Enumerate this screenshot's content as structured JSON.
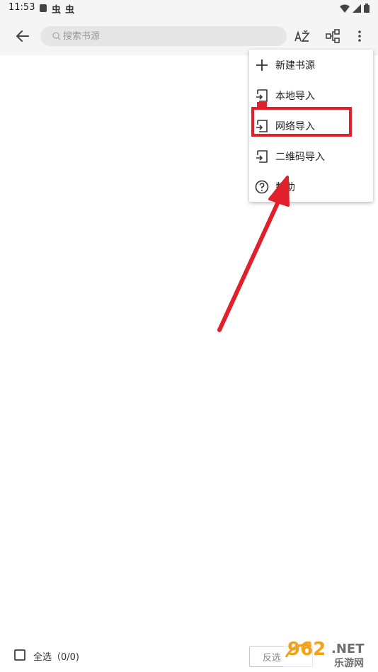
{
  "status_bar": {
    "time": "11:53",
    "bug_glyph_1": "虫",
    "bug_glyph_2": "虫"
  },
  "toolbar": {
    "search_placeholder": "搜索书源",
    "icons": [
      "back-arrow-icon",
      "search-icon",
      "sort-az-icon",
      "group-icon",
      "more-vert-icon"
    ]
  },
  "menu": {
    "items": [
      {
        "label": "新建书源",
        "icon": "plus-icon"
      },
      {
        "label": "本地导入",
        "icon": "import-icon"
      },
      {
        "label": "网络导入",
        "icon": "import-icon"
      },
      {
        "label": "二维码导入",
        "icon": "import-icon"
      },
      {
        "label": "帮助",
        "icon": "help-circle-icon"
      }
    ]
  },
  "annotation": {
    "highlight_color": "#e0202a",
    "highlighted_item": "网络导入"
  },
  "bottom_bar": {
    "select_all_label": "全选（0/0)",
    "invert_label": "反选"
  },
  "watermark": {
    "number": "962",
    "suffix": ".NET",
    "tagline": "乐游网"
  }
}
